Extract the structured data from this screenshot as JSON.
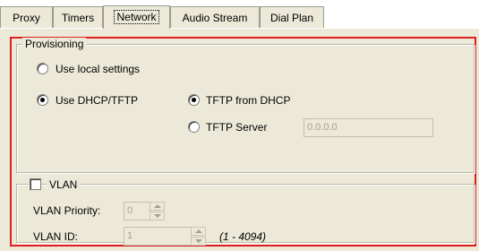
{
  "tabs": [
    {
      "label": "Proxy",
      "active": false
    },
    {
      "label": "Timers",
      "active": false
    },
    {
      "label": "Network",
      "active": true
    },
    {
      "label": "Audio Stream",
      "active": false
    },
    {
      "label": "Dial Plan",
      "active": false
    }
  ],
  "provisioning": {
    "legend": "Provisioning",
    "use_local_settings": {
      "label": "Use local settings",
      "checked": false
    },
    "use_dhcp_tftp": {
      "label": "Use DHCP/TFTP",
      "checked": true
    },
    "tftp_from_dhcp": {
      "label": "TFTP from DHCP",
      "checked": true
    },
    "tftp_server": {
      "label": "TFTP Server",
      "checked": false,
      "value": "0.0.0.0",
      "enabled": false
    }
  },
  "vlan": {
    "legend": "VLAN",
    "enabled": false,
    "priority": {
      "label": "VLAN Priority:",
      "value": "0",
      "enabled": false
    },
    "id": {
      "label": "VLAN ID:",
      "value": "1",
      "enabled": false,
      "range_hint": "(1 - 4094)"
    }
  },
  "colors": {
    "panel_bg": "#ece9d8",
    "highlight_frame": "#e02020",
    "disabled_text": "#a3a193"
  }
}
